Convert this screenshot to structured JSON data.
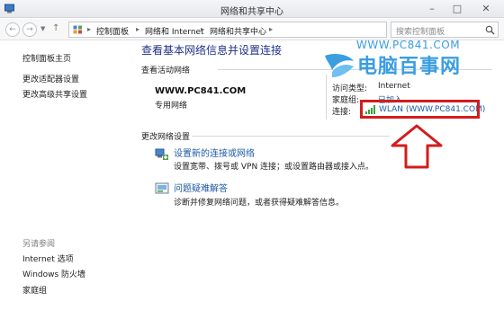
{
  "window": {
    "title": "网络和共享中心"
  },
  "address": {
    "crumbs": [
      "控制面板",
      "网络和 Internet",
      "网络和共享中心"
    ],
    "search_placeholder": "搜索控制面板"
  },
  "sidebar": {
    "top_links": [
      "控制面板主页",
      "更改适配器设置",
      "更改高级共享设置"
    ],
    "see_also_heading": "另请参阅",
    "see_also_links": [
      "Internet 选项",
      "Windows 防火墙",
      "家庭组"
    ]
  },
  "main": {
    "title": "查看基本网络信息并设置连接",
    "active_section": "查看活动网络",
    "network_name": "WWW.PC841.COM",
    "network_type": "专用网络",
    "access_type_label": "访问类型:",
    "access_type_value": "Internet",
    "homegroup_label": "家庭组:",
    "homegroup_value": "已加入",
    "connections_label": "连接:",
    "connection_link": "WLAN (WWW.PC841.COM)",
    "change_section": "更改网络设置",
    "tasks": [
      {
        "title": "设置新的连接或网络",
        "desc": "设置宽带、拨号或 VPN 连接；或设置路由器或接入点。",
        "icon": "new-connection-icon"
      },
      {
        "title": "问题疑难解答",
        "desc": "诊断并修复网络问题，或者获得疑难解答信息。",
        "icon": "troubleshoot-icon"
      }
    ]
  },
  "watermark": {
    "url": "WWW.PC841.COM",
    "cn": "电脑百事网"
  },
  "colors": {
    "link": "#1e5aa8",
    "title": "#1e3287",
    "highlight": "#d41c1c",
    "watermark": "#3a9ee0"
  }
}
